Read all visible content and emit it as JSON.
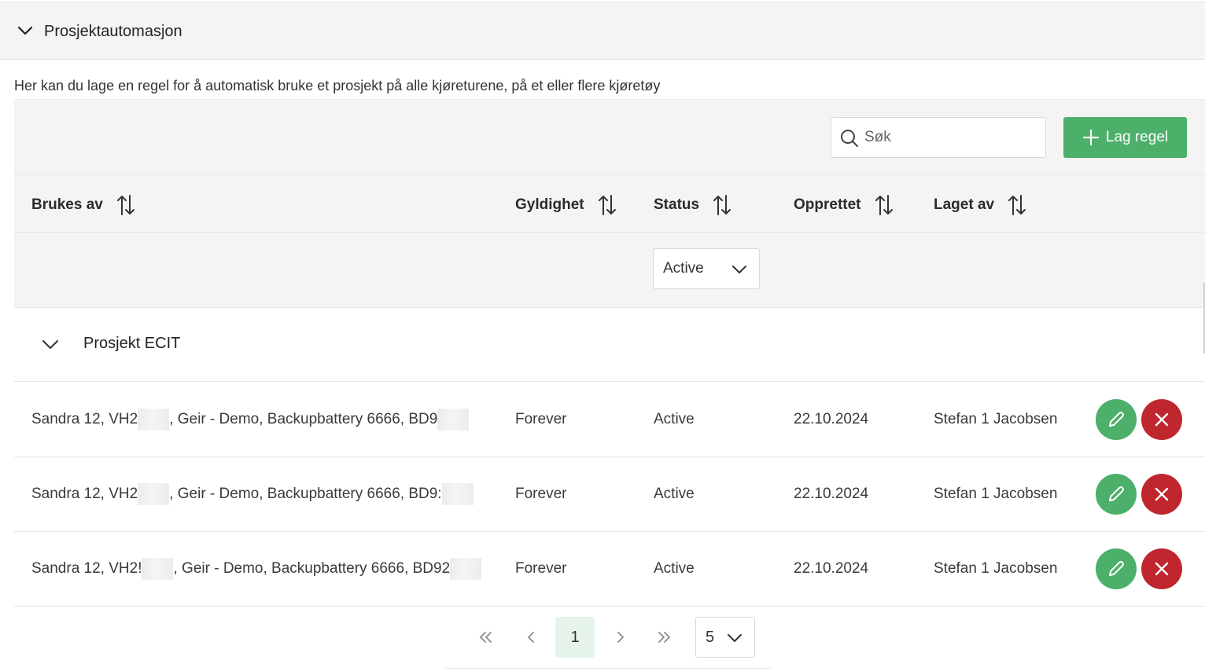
{
  "section": {
    "title": "Prosjektautomasjon",
    "description": "Her kan du lage en regel for å automatisk bruke et prosjekt på alle kjøreturene, på et eller flere kjøretøy"
  },
  "toolbar": {
    "search_placeholder": "Søk",
    "add_label": "Lag regel"
  },
  "table": {
    "columns": [
      {
        "label": "Brukes av"
      },
      {
        "label": "Gyldighet"
      },
      {
        "label": "Status"
      },
      {
        "label": "Opprettet"
      },
      {
        "label": "Laget av"
      }
    ],
    "status_filter": "Active",
    "group": {
      "name": "Prosjekt ECIT"
    },
    "rows": [
      {
        "used_by_a": "Sandra 12, VH2",
        "used_by_b": ", Geir - Demo, Backupbattery 6666, BD9",
        "validity": "Forever",
        "status": "Active",
        "created": "22.10.2024",
        "made_by": "Stefan 1 Jacobsen"
      },
      {
        "used_by_a": "Sandra 12, VH2",
        "used_by_b": ", Geir - Demo, Backupbattery 6666, BD9:",
        "validity": "Forever",
        "status": "Active",
        "created": "22.10.2024",
        "made_by": "Stefan 1 Jacobsen"
      },
      {
        "used_by_a": "Sandra 12, VH2!",
        "used_by_b": ", Geir - Demo, Backupbattery 6666, BD92",
        "validity": "Forever",
        "status": "Active",
        "created": "22.10.2024",
        "made_by": "Stefan 1 Jacobsen"
      }
    ]
  },
  "pagination": {
    "current_page": "1",
    "page_size": "5"
  },
  "colors": {
    "accent_green": "#4caf6a",
    "danger_red": "#c0262d",
    "header_bg": "#f4f4f4"
  }
}
